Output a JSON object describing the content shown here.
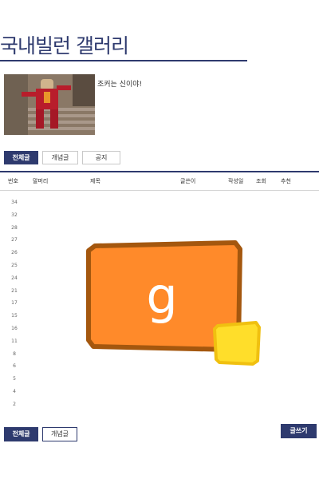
{
  "gallery": {
    "title": "국내빌런 갤러리",
    "intro_text": "조커는 신이야!"
  },
  "tabs": [
    {
      "label": "전체글",
      "active": true
    },
    {
      "label": "개념글",
      "active": false
    },
    {
      "label": "공지",
      "active": false
    }
  ],
  "table": {
    "columns": [
      "번호",
      "말머리",
      "제목",
      "글쓴이",
      "작성일",
      "조회",
      "추천"
    ],
    "row_numbers": [
      "34",
      "32",
      "28",
      "27",
      "26",
      "25",
      "24",
      "21",
      "17",
      "15",
      "16",
      "11",
      "8",
      "6",
      "5",
      "4",
      "2"
    ]
  },
  "logo": {
    "letter": "g",
    "colors": {
      "orange": "#ff8a2a",
      "border": "#a4570e",
      "yellow": "#ffde2a"
    }
  },
  "bottom": {
    "all_label": "전체글",
    "concept_label": "개념글",
    "write_label": "글쓰기"
  },
  "colors": {
    "accent": "#2e3a6e"
  }
}
